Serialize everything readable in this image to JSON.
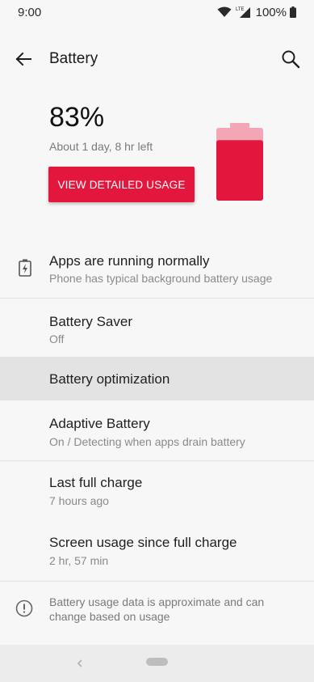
{
  "status_bar": {
    "time": "9:00",
    "network_type": "LTE",
    "battery_percent": "100%"
  },
  "app_bar": {
    "title": "Battery",
    "back_icon": "arrow-left-icon",
    "search_icon": "search-icon"
  },
  "hero": {
    "percent": "83%",
    "time_left": "About 1 day, 8 hr left",
    "detail_button": "VIEW DETAILED USAGE",
    "battery_level": 0.83,
    "battery_color": "#e3173e",
    "battery_tip_color": "#f3a6b4"
  },
  "list": {
    "apps": {
      "title": "Apps are running normally",
      "subtitle": "Phone has typical background battery usage",
      "icon": "battery-charging-icon"
    },
    "saver": {
      "title": "Battery Saver",
      "subtitle": "Off"
    },
    "optimization": {
      "title": "Battery optimization"
    },
    "adaptive": {
      "title": "Adaptive Battery",
      "subtitle": "On / Detecting when apps drain battery"
    },
    "last_charge": {
      "title": "Last full charge",
      "subtitle": "7 hours ago"
    },
    "screen_usage": {
      "title": "Screen usage since full charge",
      "subtitle": "2 hr, 57 min"
    },
    "info": {
      "text": "Battery usage data is approximate and can change based on usage",
      "icon": "info-icon"
    }
  },
  "nav": {
    "back_icon": "nav-back-icon",
    "home_icon": "home-pill-icon"
  }
}
